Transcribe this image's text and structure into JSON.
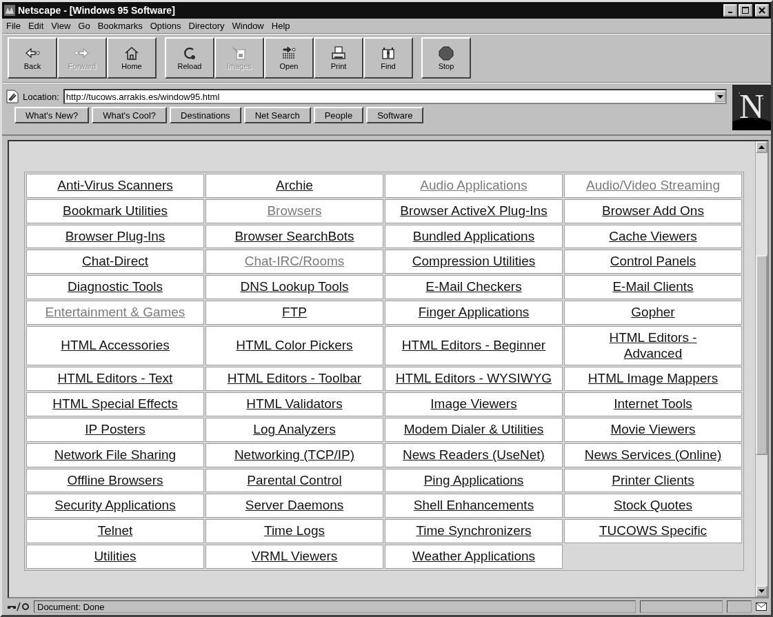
{
  "window": {
    "title": "Netscape - [Windows 95 Software]"
  },
  "menu": [
    "File",
    "Edit",
    "View",
    "Go",
    "Bookmarks",
    "Options",
    "Directory",
    "Window",
    "Help"
  ],
  "toolbar": [
    [
      {
        "label": "Back",
        "kind": "back",
        "disabled": false
      },
      {
        "label": "Forward",
        "kind": "forward",
        "disabled": true
      },
      {
        "label": "Home",
        "kind": "home",
        "disabled": false
      }
    ],
    [
      {
        "label": "Reload",
        "kind": "reload",
        "disabled": false
      },
      {
        "label": "Images",
        "kind": "images",
        "disabled": true
      },
      {
        "label": "Open",
        "kind": "open",
        "disabled": false
      },
      {
        "label": "Print",
        "kind": "print",
        "disabled": false
      },
      {
        "label": "Find",
        "kind": "find",
        "disabled": false
      }
    ],
    [
      {
        "label": "Stop",
        "kind": "stop",
        "disabled": false
      }
    ]
  ],
  "location": {
    "label": "Location:",
    "value": "http://tucows.arrakis.es/window95.html"
  },
  "directory_buttons": [
    "What's New?",
    "What's Cool?",
    "Destinations",
    "Net Search",
    "People",
    "Software"
  ],
  "logo": "N",
  "links": [
    [
      {
        "label": "Anti-Virus Scanners",
        "visited": false
      },
      {
        "label": "Archie",
        "visited": false
      },
      {
        "label": "Audio Applications",
        "visited": true
      },
      {
        "label": "Audio/Video Streaming",
        "visited": true
      }
    ],
    [
      {
        "label": "Bookmark Utilities",
        "visited": false
      },
      {
        "label": "Browsers",
        "visited": true
      },
      {
        "label": "Browser ActiveX Plug-Ins",
        "visited": false
      },
      {
        "label": "Browser Add Ons",
        "visited": false
      }
    ],
    [
      {
        "label": "Browser Plug-Ins",
        "visited": false
      },
      {
        "label": "Browser SearchBots",
        "visited": false
      },
      {
        "label": "Bundled Applications",
        "visited": false
      },
      {
        "label": "Cache Viewers",
        "visited": false
      }
    ],
    [
      {
        "label": "Chat-Direct",
        "visited": false
      },
      {
        "label": "Chat-IRC/Rooms",
        "visited": true
      },
      {
        "label": "Compression Utilities",
        "visited": false
      },
      {
        "label": "Control Panels",
        "visited": false
      }
    ],
    [
      {
        "label": "Diagnostic Tools",
        "visited": false
      },
      {
        "label": "DNS Lookup Tools",
        "visited": false
      },
      {
        "label": "E-Mail Checkers",
        "visited": false
      },
      {
        "label": "E-Mail Clients",
        "visited": false
      }
    ],
    [
      {
        "label": "Entertainment & Games",
        "visited": true
      },
      {
        "label": "FTP",
        "visited": false
      },
      {
        "label": "Finger Applications",
        "visited": false
      },
      {
        "label": "Gopher",
        "visited": false
      }
    ],
    [
      {
        "label": "HTML Accessories",
        "visited": false
      },
      {
        "label": "HTML Color Pickers",
        "visited": false
      },
      {
        "label": "HTML Editors - Beginner",
        "visited": false
      },
      {
        "label": "HTML Editors -\nAdvanced",
        "visited": false
      }
    ],
    [
      {
        "label": "HTML Editors - Text",
        "visited": false
      },
      {
        "label": "HTML Editors - Toolbar",
        "visited": false
      },
      {
        "label": "HTML Editors - WYSIWYG",
        "visited": false
      },
      {
        "label": "HTML Image Mappers",
        "visited": false
      }
    ],
    [
      {
        "label": "HTML Special Effects",
        "visited": false
      },
      {
        "label": "HTML Validators",
        "visited": false
      },
      {
        "label": "Image Viewers",
        "visited": false
      },
      {
        "label": "Internet Tools",
        "visited": false
      }
    ],
    [
      {
        "label": "IP Posters",
        "visited": false
      },
      {
        "label": "Log Analyzers",
        "visited": false
      },
      {
        "label": "Modem Dialer & Utilities",
        "visited": false
      },
      {
        "label": "Movie Viewers",
        "visited": false
      }
    ],
    [
      {
        "label": "Network File Sharing",
        "visited": false
      },
      {
        "label": "Networking (TCP/IP)",
        "visited": false
      },
      {
        "label": "News Readers (UseNet)",
        "visited": false
      },
      {
        "label": "News Services (Online)",
        "visited": false
      }
    ],
    [
      {
        "label": "Offline Browsers",
        "visited": false
      },
      {
        "label": "Parental Control",
        "visited": false
      },
      {
        "label": "Ping Applications",
        "visited": false
      },
      {
        "label": "Printer Clients",
        "visited": false
      }
    ],
    [
      {
        "label": "Security Applications",
        "visited": false
      },
      {
        "label": "Server Daemons",
        "visited": false
      },
      {
        "label": "Shell Enhancements",
        "visited": false
      },
      {
        "label": "Stock Quotes",
        "visited": false
      }
    ],
    [
      {
        "label": "Telnet",
        "visited": false
      },
      {
        "label": "Time Logs",
        "visited": false
      },
      {
        "label": "Time Synchronizers",
        "visited": false
      },
      {
        "label": "TUCOWS Specific",
        "visited": false
      }
    ],
    [
      {
        "label": "Utilities",
        "visited": false
      },
      {
        "label": "VRML Viewers",
        "visited": false
      },
      {
        "label": "Weather Applications",
        "visited": false
      }
    ]
  ],
  "status_bar": {
    "text": "Document: Done"
  }
}
